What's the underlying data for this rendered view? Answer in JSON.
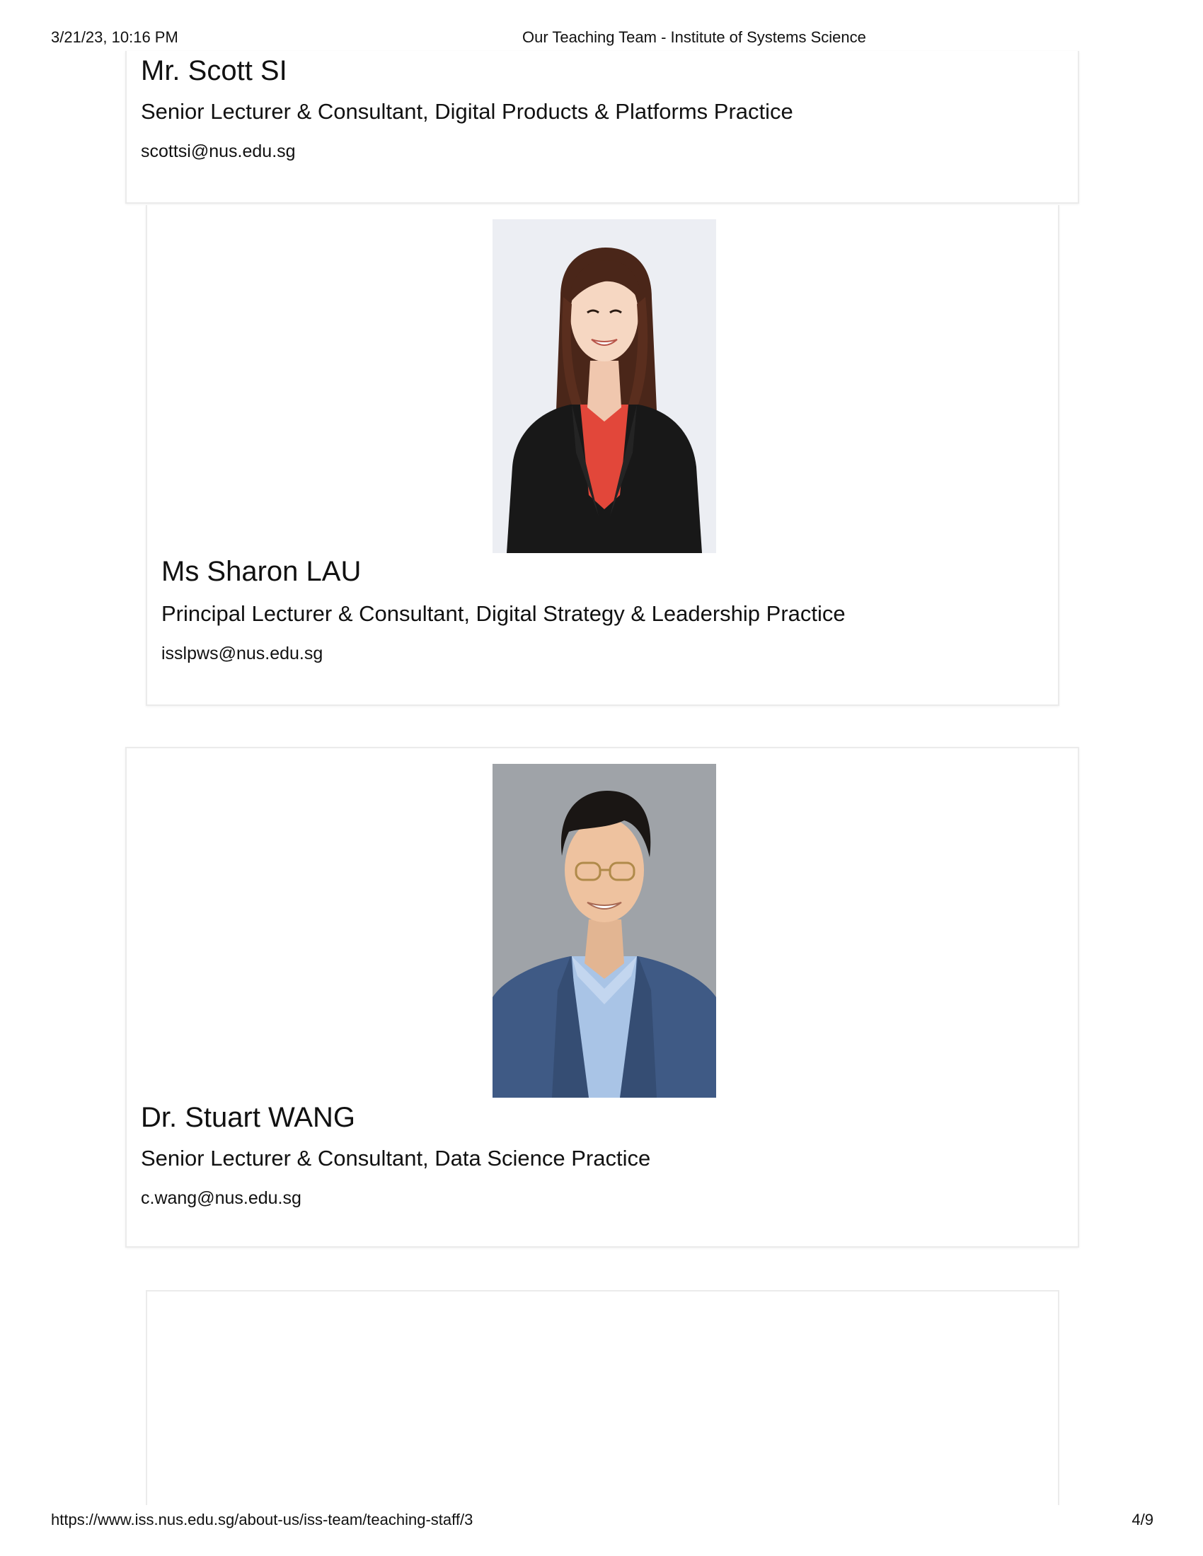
{
  "print_header": {
    "datetime": "3/21/23, 10:16 PM",
    "title": "Our Teaching Team - Institute of Systems Science"
  },
  "print_footer": {
    "url": "https://www.iss.nus.edu.sg/about-us/iss-team/teaching-staff/3",
    "page": "4/9"
  },
  "staff": [
    {
      "name": "Mr. Scott SI",
      "role": "Senior Lecturer & Consultant, Digital Products & Platforms Practice",
      "email": "scottsi@nus.edu.sg"
    },
    {
      "name": "Ms Sharon LAU",
      "role": "Principal Lecturer & Consultant, Digital Strategy & Leadership Practice",
      "email": "isslpws@nus.edu.sg"
    },
    {
      "name": "Dr. Stuart WANG",
      "role": "Senior Lecturer & Consultant, Data Science Practice",
      "email": "c.wang@nus.edu.sg"
    }
  ]
}
